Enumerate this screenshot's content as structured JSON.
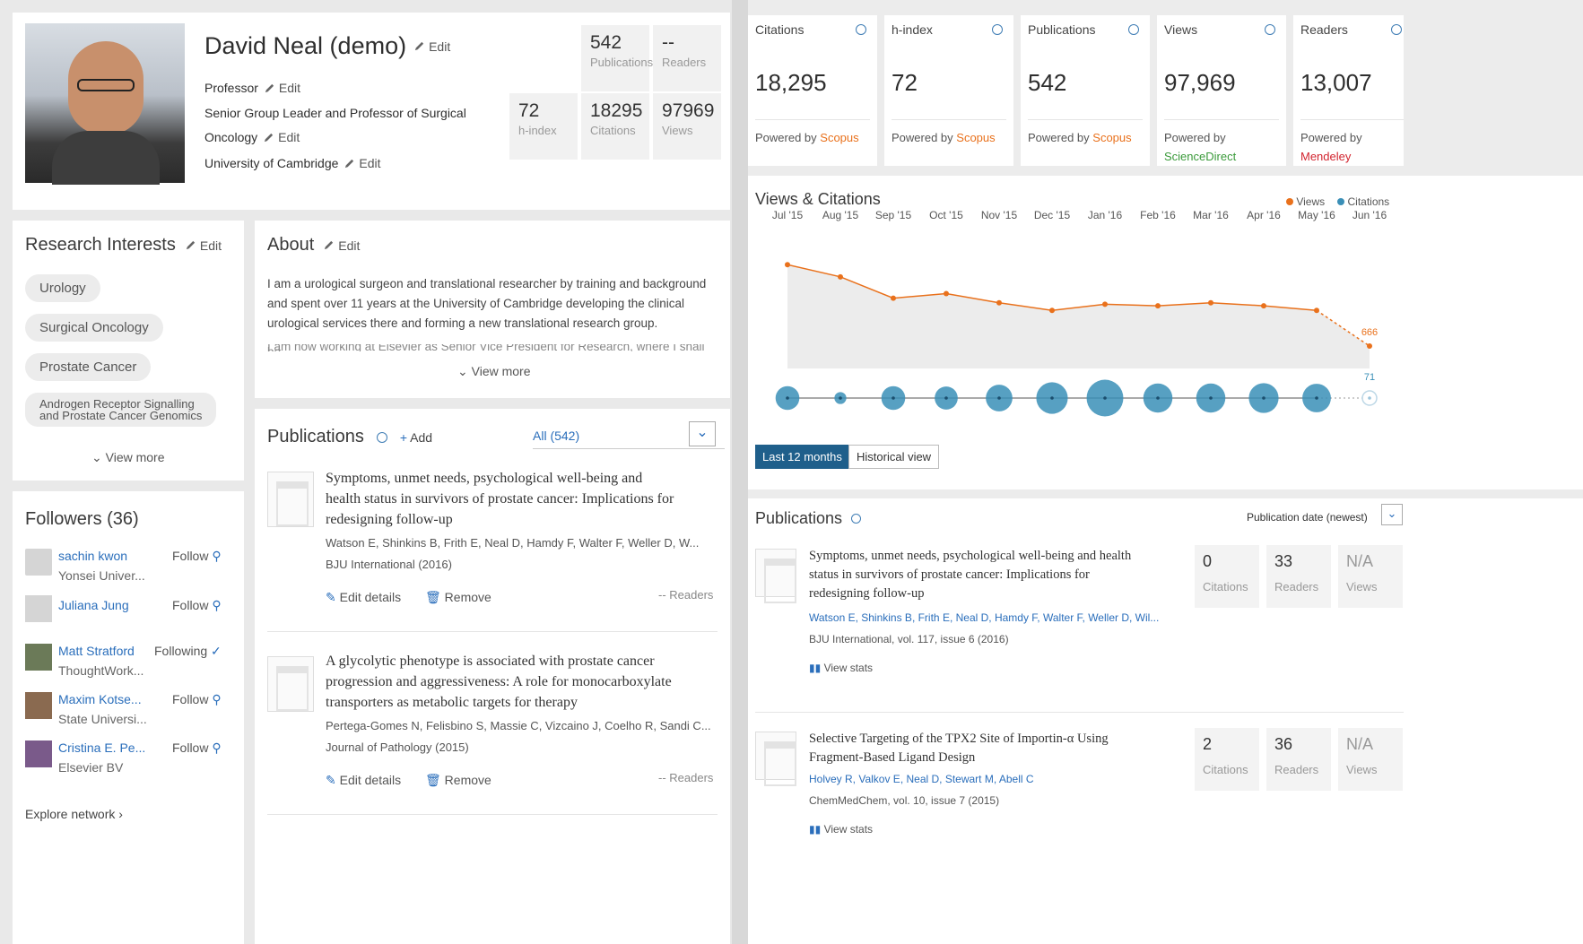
{
  "profile": {
    "name": "David Neal (demo)",
    "edit": "Edit",
    "title": "Professor",
    "role_line1": "Senior Group Leader and Professor of Surgical",
    "role_line2": "Oncology",
    "affiliation": "University of Cambridge",
    "stats": [
      {
        "value": "542",
        "label": "Publications"
      },
      {
        "value": "--",
        "label": "Readers"
      },
      {
        "value": "72",
        "label": "h-index"
      },
      {
        "value": "18295",
        "label": "Citations"
      },
      {
        "value": "97969",
        "label": "Views"
      }
    ]
  },
  "research_interests": {
    "title": "Research Interests",
    "edit": "Edit",
    "items": [
      "Urology",
      "Surgical Oncology",
      "Prostate Cancer",
      "Androgen Receptor Signalling",
      "and Prostate Cancer Genomics"
    ],
    "view_more": "View more"
  },
  "about": {
    "title": "About",
    "edit": "Edit",
    "text_line1": "I am a urological surgeon and translational researcher by training and background",
    "text_line2": "and spent over 11 years at the University of Cambridge developing the clinical",
    "text_line3": "urological services there and forming a new translational research group.",
    "text_line4": "I am now working at Elsevier as Senior Vice President for Research, where I shall be",
    "view_more": "View more"
  },
  "followers": {
    "title": "Followers (36)",
    "items": [
      {
        "name": "sachin kwon",
        "org": "Yonsei Univer...",
        "action": "Follow"
      },
      {
        "name": "Juliana Jung",
        "org": "",
        "action": "Follow"
      },
      {
        "name": "Matt Stratford",
        "org": "ThoughtWork...",
        "action": "Following"
      },
      {
        "name": "Maxim Kotse...",
        "org": "State Universi...",
        "action": "Follow"
      },
      {
        "name": "Cristina E. Pe...",
        "org": "Elsevier BV",
        "action": "Follow"
      }
    ],
    "explore": "Explore network"
  },
  "publications_left": {
    "title": "Publications",
    "add": "Add",
    "filter": "All (542)",
    "items": [
      {
        "title_l1": "Symptoms, unmet needs, psychological well-being and",
        "title_l2": "health status in survivors of prostate cancer: Implications for",
        "title_l3": "redesigning follow-up",
        "authors": "Watson E, Shinkins B, Frith E, Neal D, Hamdy F, Walter F, Weller D, W...",
        "journal": "BJU International (2016)",
        "edit": "Edit details",
        "remove": "Remove",
        "readers": "-- Readers"
      },
      {
        "title_l1": "A glycolytic phenotype is associated with prostate cancer",
        "title_l2": "progression and aggressiveness: A role for monocarboxylate",
        "title_l3": "transporters as metabolic targets for therapy",
        "authors": "Pertega-Gomes N, Felisbino S, Massie C, Vizcaino J, Coelho R, Sandi C...",
        "journal": "Journal of Pathology (2015)",
        "edit": "Edit details",
        "remove": "Remove",
        "readers": "-- Readers"
      }
    ]
  },
  "metrics": [
    {
      "label": "Citations",
      "value": "18,295",
      "powered1": "Powered by",
      "powered2": "Scopus",
      "powered3": ""
    },
    {
      "label": "h-index",
      "value": "72",
      "powered1": "Powered by",
      "powered2": "Scopus",
      "powered3": ""
    },
    {
      "label": "Publications",
      "value": "542",
      "powered1": "Powered by",
      "powered2": "Scopus",
      "powered3": ""
    },
    {
      "label": "Views",
      "value": "97,969",
      "powered1": "Powered by",
      "powered2": "",
      "powered3": "ScienceDirect"
    },
    {
      "label": "Readers",
      "value": "13,007",
      "powered1": "Powered by",
      "powered2": "",
      "powered3": "Mendeley"
    }
  ],
  "views_citations": {
    "title": "Views & Citations",
    "legend_views": "Views",
    "legend_citations": "Citations",
    "last_label": "666",
    "last_cite_label": "71",
    "btn_last12": "Last 12 months",
    "btn_historical": "Historical view",
    "colors": {
      "views": "#e9711c",
      "citations": "#3a8fb7"
    }
  },
  "chart_data": {
    "type": "line",
    "categories": [
      "Jul '15",
      "Aug '15",
      "Sep '15",
      "Oct '15",
      "Nov '15",
      "Dec '15",
      "Jan '16",
      "Feb '16",
      "Mar '16",
      "Apr '16",
      "May '16",
      "Jun '16"
    ],
    "series": [
      {
        "name": "Views",
        "values": [
          1200,
          1120,
          980,
          1010,
          950,
          900,
          940,
          930,
          950,
          930,
          900,
          666
        ]
      },
      {
        "name": "Citations",
        "values": [
          160,
          40,
          160,
          150,
          200,
          280,
          380,
          240,
          240,
          250,
          230,
          71
        ]
      }
    ]
  },
  "publications_right": {
    "title": "Publications",
    "sort": "Publication date (newest)",
    "items": [
      {
        "title_l1": "Symptoms, unmet needs, psychological well-being and health",
        "title_l2": "status in survivors of prostate cancer: Implications for",
        "title_l3": "redesigning follow-up",
        "authors": "Watson E, Shinkins B, Frith E, Neal D, Hamdy F, Walter F, Weller D, Wil...",
        "journal": "BJU International, vol. 117, issue 6 (2016)",
        "citations": "0",
        "readers": "33",
        "views": "N/A",
        "citations_label": "Citations",
        "readers_label": "Readers",
        "views_label": "Views",
        "view_stats": "View stats"
      },
      {
        "title_l1": "Selective Targeting of the TPX2 Site of Importin-α Using",
        "title_l2": "Fragment-Based Ligand Design",
        "title_l3": "",
        "authors": "Holvey R, Valkov E, Neal D, Stewart M, Abell C",
        "journal": "ChemMedChem, vol. 10, issue 7 (2015)",
        "citations": "2",
        "readers": "36",
        "views": "N/A",
        "citations_label": "Citations",
        "readers_label": "Readers",
        "views_label": "Views",
        "view_stats": "View stats"
      }
    ]
  }
}
